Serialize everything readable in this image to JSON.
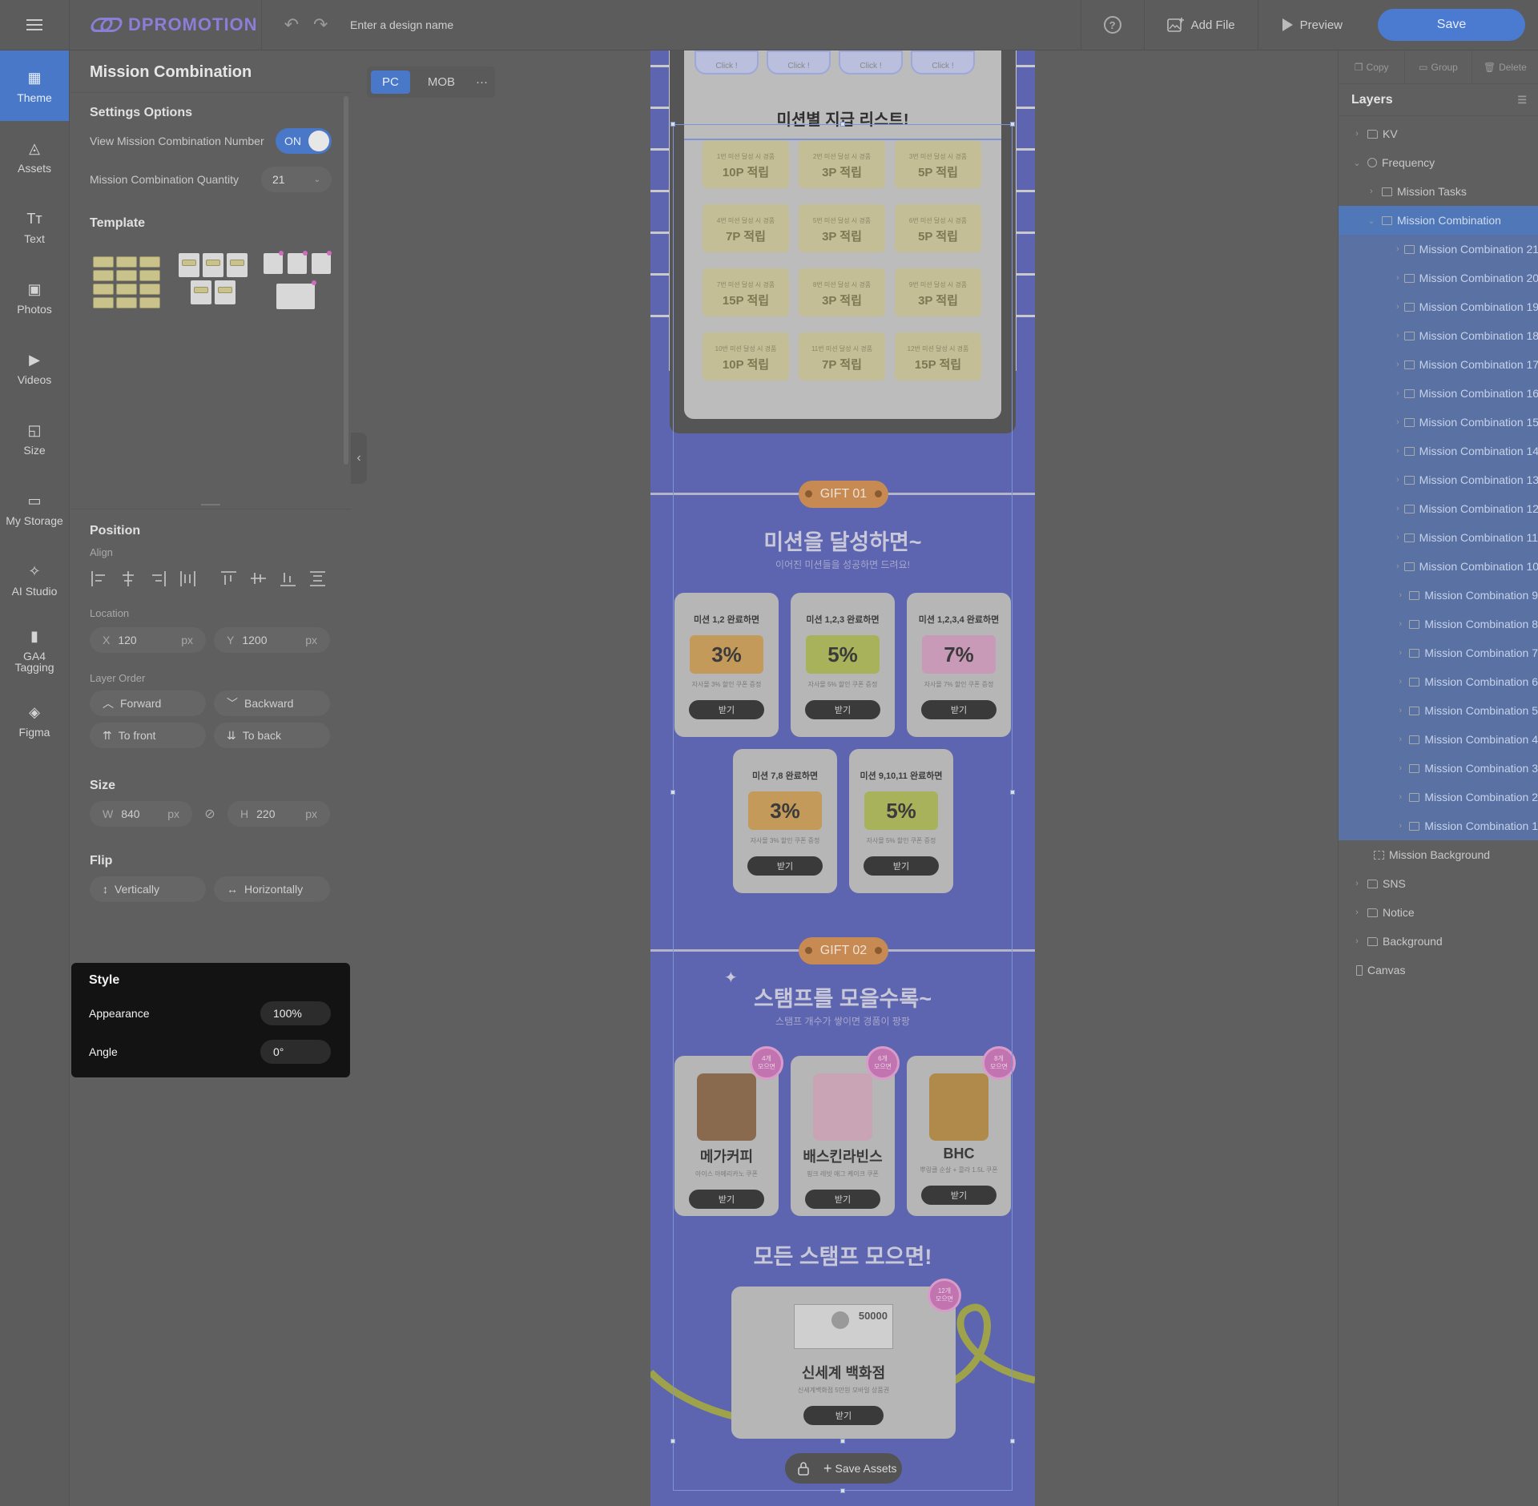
{
  "app": {
    "logo_text": "DPROMOTION",
    "design_name_placeholder": "Enter a design name",
    "add_file": "Add File",
    "preview": "Preview",
    "save": "Save"
  },
  "nav": [
    {
      "label": "Theme",
      "icon": "theme-icon",
      "active": true
    },
    {
      "label": "Assets",
      "icon": "assets-icon"
    },
    {
      "label": "Text",
      "icon": "text-icon"
    },
    {
      "label": "Photos",
      "icon": "photos-icon"
    },
    {
      "label": "Videos",
      "icon": "videos-icon"
    },
    {
      "label": "Size",
      "icon": "size-icon"
    },
    {
      "label": "My Storage",
      "icon": "folder-icon"
    },
    {
      "label": "AI Studio",
      "icon": "magic-wand-icon"
    },
    {
      "label": "GA4\nTagging",
      "icon": "bar-chart-icon"
    },
    {
      "label": "Figma",
      "icon": "figma-icon"
    }
  ],
  "panel": {
    "title": "Mission Combination",
    "settings_title": "Settings Options",
    "view_number_label": "View Mission Combination Number",
    "toggle_label": "ON",
    "quantity_label": "Mission Combination Quantity",
    "quantity_value": "21",
    "template_title": "Template",
    "position_title": "Position",
    "align_label": "Align",
    "location_label": "Location",
    "x_label": "X",
    "x_value": "120",
    "x_unit": "px",
    "y_label": "Y",
    "y_value": "1200",
    "y_unit": "px",
    "layer_order_label": "Layer Order",
    "forward": "Forward",
    "backward": "Backward",
    "to_front": "To front",
    "to_back": "To back",
    "size_title": "Size",
    "w_label": "W",
    "w_value": "840",
    "w_unit": "px",
    "h_label": "H",
    "h_value": "220",
    "h_unit": "px",
    "flip_title": "Flip",
    "vertically": "Vertically",
    "horizontally": "Horizontally"
  },
  "style": {
    "title": "Style",
    "appearance_label": "Appearance",
    "appearance_value": "100%",
    "angle_label": "Angle",
    "angle_value": "0°"
  },
  "canvas": {
    "tab_pc": "PC",
    "tab_mob": "MOB",
    "more": "···",
    "click_label": "Click !",
    "mission_list_title": "미션별 지급 리스트!",
    "mission_tickets": [
      {
        "sub": "1번 미션 달성 시 경품",
        "reward": "10P 적립"
      },
      {
        "sub": "2번 미션 달성 시 경품",
        "reward": "3P 적립"
      },
      {
        "sub": "3번 미션 달성 시 경품",
        "reward": "5P 적립"
      },
      {
        "sub": "4번 미션 달성 시 경품",
        "reward": "7P 적립"
      },
      {
        "sub": "5번 미션 달성 시 경품",
        "reward": "3P 적립"
      },
      {
        "sub": "6번 미션 달성 시 경품",
        "reward": "5P 적립"
      },
      {
        "sub": "7번 미션 달성 시 경품",
        "reward": "15P 적립"
      },
      {
        "sub": "8번 미션 달성 시 경품",
        "reward": "3P 적립"
      },
      {
        "sub": "9번 미션 달성 시 경품",
        "reward": "3P 적립"
      },
      {
        "sub": "10번 미션 달성 시 경품",
        "reward": "10P 적립"
      },
      {
        "sub": "11번 미션 달성 시 경품",
        "reward": "7P 적립"
      },
      {
        "sub": "12번 미션 달성 시 경품",
        "reward": "15P 적립"
      }
    ],
    "gift1_badge": "GIFT 01",
    "gift1_title": "미션을 달성하면~",
    "gift1_sub": "이어진 미션들을 성공하면 드려요!",
    "gift_cards": [
      {
        "title": "미션 1,2 완료하면",
        "value": "3%",
        "desc": "자사몰 3% 할인 쿠폰 증정",
        "btn": "받기",
        "color": "#c49a5a"
      },
      {
        "title": "미션 1,2,3 완료하면",
        "value": "5%",
        "desc": "자사몰 5% 할인 쿠폰 증정",
        "btn": "받기",
        "color": "#a8b25a"
      },
      {
        "title": "미션 1,2,3,4 완료하면",
        "value": "7%",
        "desc": "자사몰 7% 할인 쿠폰 증정",
        "btn": "받기",
        "color": "#c99ab8"
      },
      {
        "title": "미션 7,8 완료하면",
        "value": "3%",
        "desc": "자사몰 3% 할인 쿠폰 증정",
        "btn": "받기",
        "color": "#c49a5a"
      },
      {
        "title": "미션 9,10,11 완료하면",
        "value": "5%",
        "desc": "자사몰 5% 할인 쿠폰 증정",
        "btn": "받기",
        "color": "#a8b25a"
      }
    ],
    "gift2_badge": "GIFT 02",
    "gift2_title": "스탬프를 모을수록~",
    "gift2_sub": "스탬프 개수가 쌓이면 경품이 팡팡",
    "stamp_cards": [
      {
        "name": "메가커피",
        "desc": "아이스 아메리카노 쿠폰",
        "btn": "받기",
        "badge": "4개\n모으면"
      },
      {
        "name": "배스킨라빈스",
        "desc": "핑크 레빗 애그 케이크 쿠폰",
        "btn": "받기",
        "badge": "6개\n모으면"
      },
      {
        "name": "BHC",
        "desc": "뿌링클 순살 + 콜라 1.5L 쿠폰",
        "btn": "받기",
        "badge": "8개\n모으면"
      }
    ],
    "all_stamps_title": "모든 스탬프 모으면!",
    "final_card": {
      "amount": "50000",
      "name": "신세계 백화점",
      "desc": "신세계백화점 5만원 모바일 상품권",
      "btn": "받기",
      "badge": "12개\n모으면"
    },
    "save_assets": "Save Assets"
  },
  "right": {
    "copy": "Copy",
    "group": "Group",
    "delete": "Delete",
    "layers_title": "Layers",
    "layers": [
      {
        "label": "KV",
        "indent": 0,
        "icon": "folder",
        "chev": "›"
      },
      {
        "label": "Frequency",
        "indent": 0,
        "icon": "globe",
        "chev": "⌄"
      },
      {
        "label": "Mission Tasks",
        "indent": 1,
        "icon": "list",
        "chev": "›"
      },
      {
        "label": "Mission Combination",
        "indent": 1,
        "icon": "list",
        "chev": "⌄",
        "state": "sel"
      },
      {
        "label": "Mission Combination 21",
        "indent": 2,
        "icon": "list",
        "chev": "›",
        "state": "subsel"
      },
      {
        "label": "Mission Combination 20",
        "indent": 2,
        "icon": "list",
        "chev": "›",
        "state": "subsel"
      },
      {
        "label": "Mission Combination 19",
        "indent": 2,
        "icon": "list",
        "chev": "›",
        "state": "subsel"
      },
      {
        "label": "Mission Combination 18",
        "indent": 2,
        "icon": "list",
        "chev": "›",
        "state": "subsel"
      },
      {
        "label": "Mission Combination 17",
        "indent": 2,
        "icon": "list",
        "chev": "›",
        "state": "subsel"
      },
      {
        "label": "Mission Combination 16",
        "indent": 2,
        "icon": "list",
        "chev": "›",
        "state": "subsel"
      },
      {
        "label": "Mission Combination 15",
        "indent": 2,
        "icon": "list",
        "chev": "›",
        "state": "subsel"
      },
      {
        "label": "Mission Combination 14",
        "indent": 2,
        "icon": "list",
        "chev": "›",
        "state": "subsel"
      },
      {
        "label": "Mission Combination 13",
        "indent": 2,
        "icon": "list",
        "chev": "›",
        "state": "subsel"
      },
      {
        "label": "Mission Combination 12",
        "indent": 2,
        "icon": "list",
        "chev": "›",
        "state": "subsel"
      },
      {
        "label": "Mission Combination 11",
        "indent": 2,
        "icon": "list",
        "chev": "›",
        "state": "subsel"
      },
      {
        "label": "Mission Combination 10",
        "indent": 2,
        "icon": "list",
        "chev": "›",
        "state": "subsel"
      },
      {
        "label": "Mission Combination 9",
        "indent": 2,
        "icon": "list",
        "chev": "›",
        "state": "subsel"
      },
      {
        "label": "Mission Combination 8",
        "indent": 2,
        "icon": "list",
        "chev": "›",
        "state": "subsel"
      },
      {
        "label": "Mission Combination 7",
        "indent": 2,
        "icon": "list",
        "chev": "›",
        "state": "subsel"
      },
      {
        "label": "Mission Combination 6",
        "indent": 2,
        "icon": "list",
        "chev": "›",
        "state": "subsel"
      },
      {
        "label": "Mission Combination 5",
        "indent": 2,
        "icon": "list",
        "chev": "›",
        "state": "subsel"
      },
      {
        "label": "Mission Combination 4",
        "indent": 2,
        "icon": "list",
        "chev": "›",
        "state": "subsel"
      },
      {
        "label": "Mission Combination 3",
        "indent": 2,
        "icon": "list",
        "chev": "›",
        "state": "subsel"
      },
      {
        "label": "Mission Combination 2",
        "indent": 2,
        "icon": "list",
        "chev": "›",
        "state": "subsel"
      },
      {
        "label": "Mission Combination 1",
        "indent": 2,
        "icon": "list",
        "chev": "›",
        "state": "subsel"
      },
      {
        "label": "Mission Background",
        "indent": 1,
        "icon": "frame",
        "chev": ""
      },
      {
        "label": "SNS",
        "indent": 0,
        "icon": "folder",
        "chev": "›"
      },
      {
        "label": "Notice",
        "indent": 0,
        "icon": "folder",
        "chev": "›"
      },
      {
        "label": "Background",
        "indent": 0,
        "icon": "folder",
        "chev": "›"
      },
      {
        "label": "Canvas",
        "indent": -1,
        "icon": "rect",
        "chev": ""
      }
    ]
  }
}
